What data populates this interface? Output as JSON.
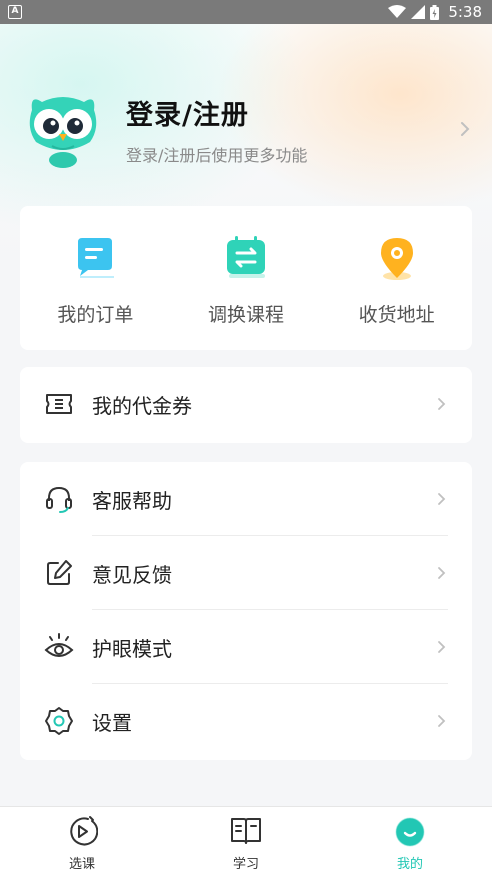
{
  "status_bar": {
    "time": "5:38",
    "app_icon_letter": "A"
  },
  "profile": {
    "title": "登录/注册",
    "subtitle": "登录/注册后使用更多功能"
  },
  "quick_actions": [
    {
      "label": "我的订单",
      "icon": "order-icon",
      "color": "#3cc4f0"
    },
    {
      "label": "调换课程",
      "icon": "swap-course-icon",
      "color": "#2fd3b8"
    },
    {
      "label": "收货地址",
      "icon": "location-pin-icon",
      "color": "#ffb21f"
    }
  ],
  "voucher": {
    "label": "我的代金券",
    "icon": "ticket-icon"
  },
  "menu": [
    {
      "label": "客服帮助",
      "icon": "headset-icon"
    },
    {
      "label": "意见反馈",
      "icon": "edit-icon"
    },
    {
      "label": "护眼模式",
      "icon": "eye-icon"
    },
    {
      "label": "设置",
      "icon": "gear-icon"
    }
  ],
  "tabs": [
    {
      "label": "选课",
      "icon": "play-circle-icon",
      "active": false
    },
    {
      "label": "学习",
      "icon": "book-icon",
      "active": false
    },
    {
      "label": "我的",
      "icon": "smile-icon",
      "active": true
    }
  ],
  "colors": {
    "accent": "#22c7b4",
    "chevron": "#c0c0c0"
  }
}
